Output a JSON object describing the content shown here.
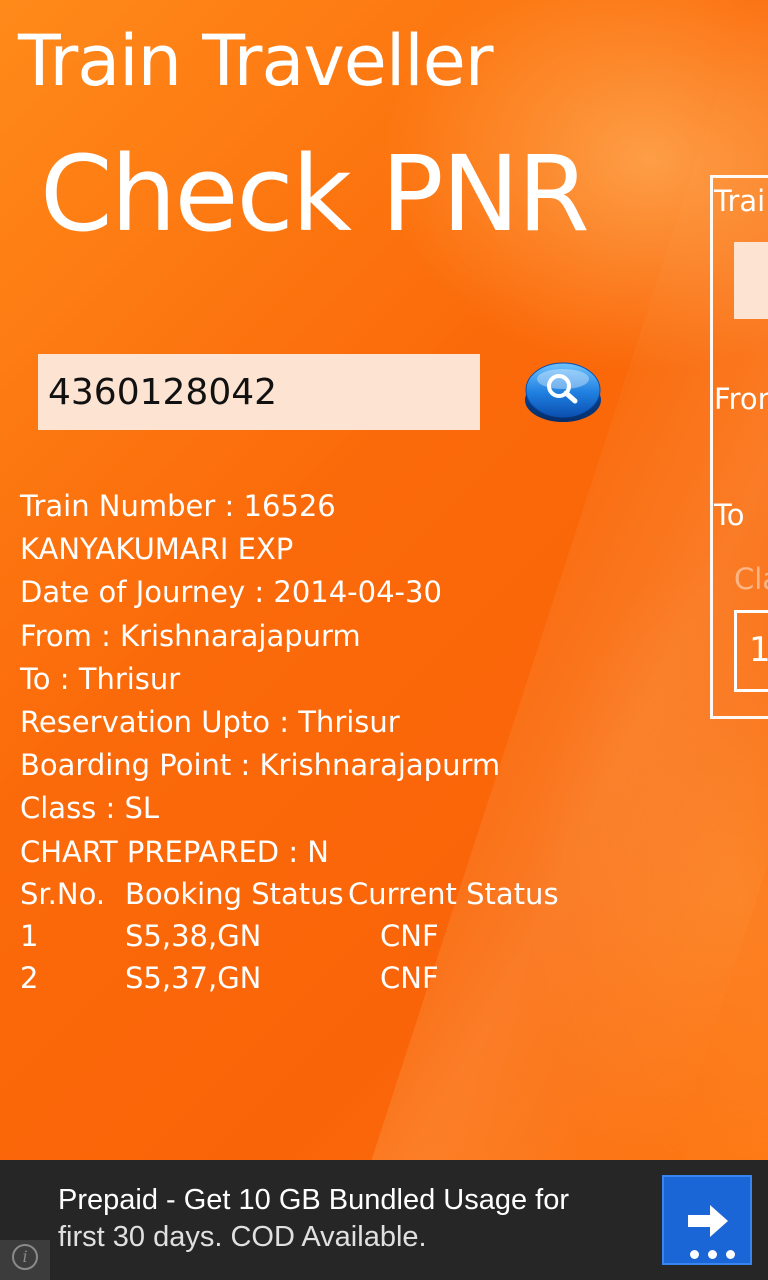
{
  "app": {
    "title": "Train Traveller",
    "page_title": "Check PNR"
  },
  "search": {
    "pnr_value": "4360128042",
    "button_icon": "search-icon"
  },
  "details": {
    "train_number": "Train Number : 16526",
    "train_name": "KANYAKUMARI EXP",
    "date_of_journey": "Date of Journey : 2014-04-30",
    "from": "From : Krishnarajapurm",
    "to": "To : Thrisur",
    "reservation_upto": "Reservation Upto : Thrisur",
    "boarding_point": "Boarding Point : Krishnarajapurm",
    "class": "Class :  SL",
    "chart_prepared": "CHART PREPARED : N"
  },
  "passengers": {
    "headers": [
      "Sr.No.",
      "Booking Status",
      "Current Status"
    ],
    "rows": [
      [
        "1",
        "S5,38,GN",
        "CNF"
      ],
      [
        "2",
        "S5,37,GN",
        "CNF"
      ]
    ]
  },
  "side_panel": {
    "label_train": "Trai",
    "label_from": "Fron",
    "label_to": "To",
    "label_class": "Cla",
    "box_value": "1"
  },
  "ad": {
    "line1": "Prepaid - Get 10 GB Bundled Usage for",
    "line2": "first 30 days. COD Available.",
    "info_icon": "i",
    "arrow_icon": "arrow-right-icon"
  },
  "colors": {
    "background": "#f96408",
    "input_background": "#fde3d2",
    "ad_background": "#262626",
    "ad_button": "#1a66d6"
  }
}
